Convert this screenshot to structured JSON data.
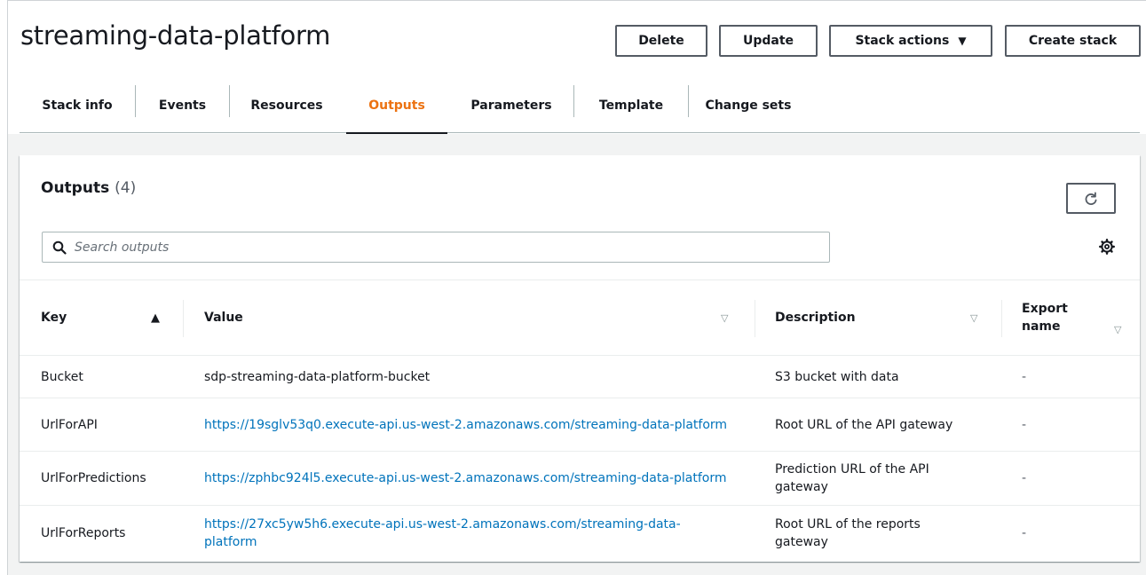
{
  "stack": {
    "title": "streaming-data-platform"
  },
  "header_buttons": {
    "delete": "Delete",
    "update": "Update",
    "stack_actions": "Stack actions",
    "create_stack": "Create stack"
  },
  "tabs": [
    {
      "label": "Stack info",
      "active": false
    },
    {
      "label": "Events",
      "active": false
    },
    {
      "label": "Resources",
      "active": false
    },
    {
      "label": "Outputs",
      "active": true
    },
    {
      "label": "Parameters",
      "active": false
    },
    {
      "label": "Template",
      "active": false
    },
    {
      "label": "Change sets",
      "active": false
    }
  ],
  "outputs": {
    "title": "Outputs",
    "count": "(4)",
    "search_placeholder": "Search outputs",
    "columns": {
      "key": "Key",
      "value": "Value",
      "description": "Description",
      "export_name_line1": "Export",
      "export_name_line2": "name"
    },
    "rows": [
      {
        "key": "Bucket",
        "value": "sdp-streaming-data-platform-bucket",
        "is_link": false,
        "description": "S3 bucket with data",
        "export": "-"
      },
      {
        "key": "UrlForAPI",
        "value": "https://19sglv53q0.execute-api.us-west-2.amazonaws.com/streaming-data-platform",
        "is_link": true,
        "description": "Root URL of the API gateway",
        "export": "-"
      },
      {
        "key": "UrlForPredictions",
        "value": "https://zphbc924l5.execute-api.us-west-2.amazonaws.com/streaming-data-platform",
        "is_link": true,
        "description": "Prediction URL of the API gateway",
        "export": "-"
      },
      {
        "key": "UrlForReports",
        "value": "https://27xc5yw5h6.execute-api.us-west-2.amazonaws.com/streaming-data-platform",
        "is_link": true,
        "description": "Root URL of the reports gateway",
        "export": "-"
      }
    ]
  },
  "colors": {
    "accent": "#ec7211",
    "link": "#0073bb",
    "text": "#16191f",
    "border": "#aab7b8",
    "panel_bg": "#f2f3f3"
  },
  "icons": {
    "refresh": "refresh-icon",
    "search": "search-icon",
    "settings": "gear-icon",
    "sort_asc": "sort-ascending-icon",
    "sort": "sort-icon",
    "caret": "caret-down-icon"
  }
}
